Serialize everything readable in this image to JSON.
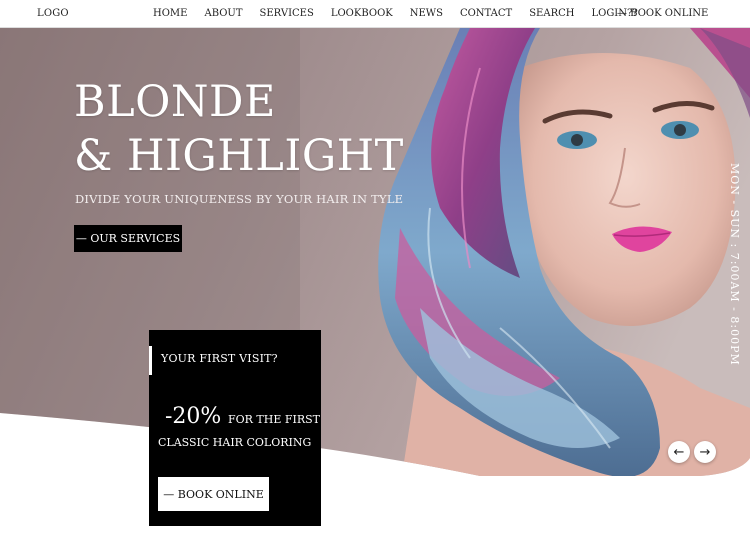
{
  "nav": {
    "logo": "LOGO",
    "items": [
      "HOME",
      "ABOUT",
      "SERVICES",
      "LOOKBOOK",
      "NEWS",
      "CONTACT",
      "SEARCH",
      "LOGIN??"
    ],
    "book_online": "— BOOK ONLINE"
  },
  "hero": {
    "title_line1": "BLONDE",
    "title_line2": "& HIGHLIGHT",
    "tagline": "DIVIDE YOUR UNIQUENESS BY YOUR HAIR IN TYLE",
    "services_button": "— OUR SERVICES",
    "hours": "MON - SUN : 7:00AM - 8:00PM",
    "prev_arrow": "←",
    "next_arrow": "→"
  },
  "promo": {
    "question": "YOUR FIRST VISIT?",
    "discount": "-20%",
    "for_text": "FOR THE FIRST",
    "classic_text": "CLASSIC HAIR COLORING",
    "book_button": "— BOOK ONLINE"
  },
  "colors": {
    "hero_bg": "#9a8586",
    "button_bg": "#000000",
    "text_light": "#ffffff"
  }
}
